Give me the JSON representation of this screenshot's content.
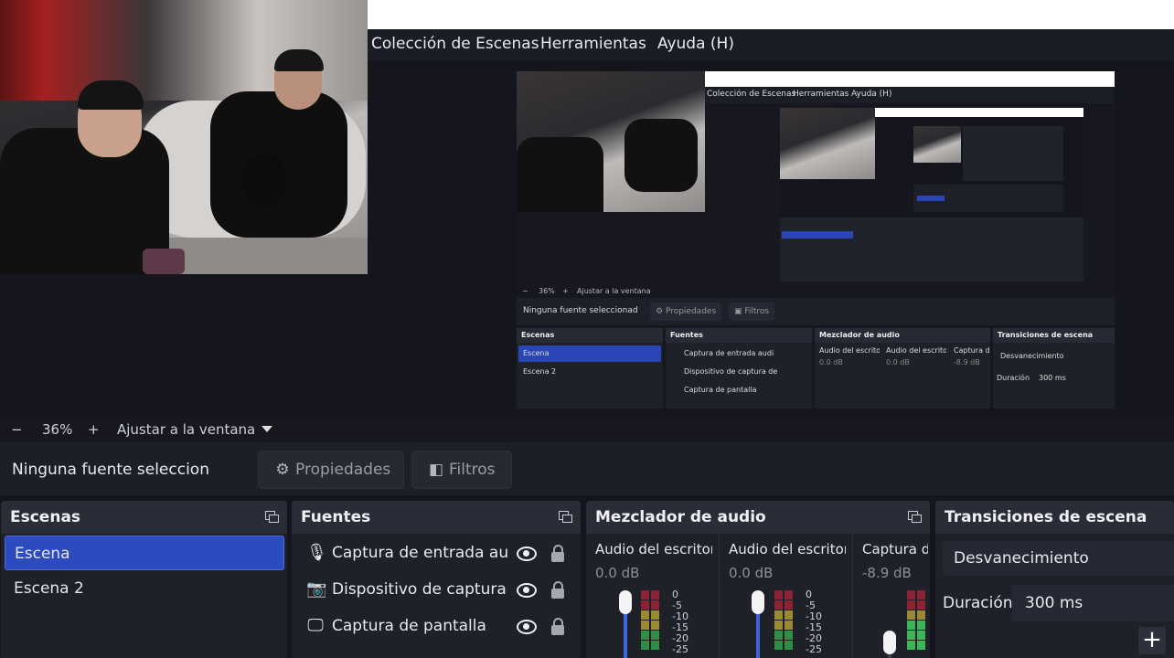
{
  "menu": {
    "items": [
      "Colección de Escenas",
      "Herramientas",
      "Ayuda (H)"
    ]
  },
  "preview": {
    "menu_items": [
      "Colección de Escenas",
      "Herramientas",
      "Ayuda (H)"
    ],
    "zoom_value": "36%",
    "fit_label": "Ajustar a la ventana",
    "no_source": "Ninguna fuente seleccionad",
    "properties_label": "Propiedades",
    "filters_label": "Filtros",
    "docks": {
      "scenes_title": "Escenas",
      "sources_title": "Fuentes",
      "mixer_title": "Mezclador de audio",
      "transitions_title": "Transiciones de escena",
      "scenes": [
        "Escena",
        "Escena 2"
      ],
      "sources": [
        "Captura de entrada audi",
        "Dispositivo de captura de",
        "Captura de pantalla"
      ],
      "channels": [
        "Audio del escritorio",
        "Audio del escritorio",
        "Captura de"
      ],
      "channel_db": [
        "0.0 dB",
        "0.0 dB",
        "-8.9 dB"
      ],
      "transition": "Desvanecimiento",
      "duration_label": "Duración",
      "duration_value": "300 ms"
    }
  },
  "zoom": {
    "minus": "−",
    "value": "36%",
    "plus": "+",
    "fit_label": "Ajustar a la ventana"
  },
  "properties_bar": {
    "no_source": "Ninguna fuente seleccionad",
    "properties_label": "Propiedades",
    "filters_label": "Filtros"
  },
  "scenes": {
    "title": "Escenas",
    "items": [
      {
        "label": "Escena",
        "selected": true
      },
      {
        "label": "Escena 2",
        "selected": false
      }
    ]
  },
  "sources": {
    "title": "Fuentes",
    "items": [
      {
        "label": "Captura de entrada audi",
        "icon": "microphone-icon"
      },
      {
        "label": "Dispositivo de captura de",
        "icon": "camera-icon"
      },
      {
        "label": "Captura de pantalla",
        "icon": "monitor-icon"
      }
    ]
  },
  "mixer": {
    "title": "Mezclador de audio",
    "channels": [
      {
        "name": "Audio del escritorio",
        "db": "0.0 dB",
        "level": 1.0
      },
      {
        "name": "Audio del escritorio",
        "db": "0.0 dB",
        "level": 1.0
      },
      {
        "name": "Captura de",
        "db": "-8.9 dB",
        "level": 0.7
      }
    ],
    "scale": [
      "0",
      "-5",
      "-10",
      "-15",
      "-20",
      "-25"
    ]
  },
  "transitions": {
    "title": "Transiciones de escena",
    "selected": "Desvanecimiento",
    "duration_label": "Duración",
    "duration_value": "300 ms",
    "add_label": "+"
  },
  "colors": {
    "accent": "#2c4bbf",
    "meter_green": "#3bb55a",
    "meter_yellow": "#b7a43a",
    "meter_red": "#b2283a"
  }
}
